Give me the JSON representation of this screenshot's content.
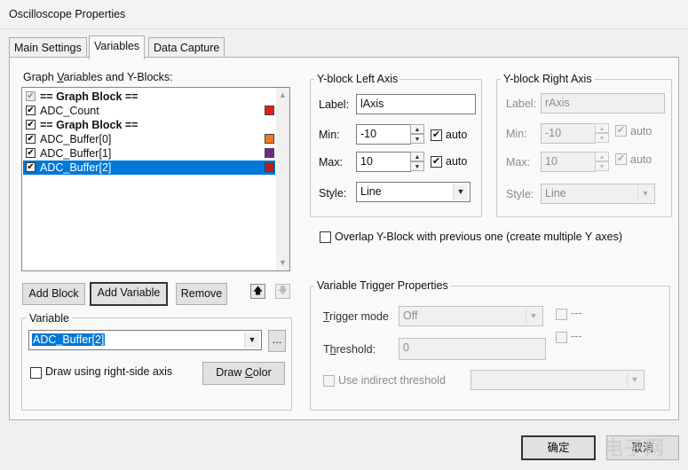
{
  "window": {
    "title": "Oscilloscope Properties"
  },
  "tabs": [
    "Main Settings",
    "Variables",
    "Data Capture"
  ],
  "graph_list": {
    "title": "Graph Variables and Y-Blocks:",
    "title_mnemonic": "V",
    "items": [
      {
        "label": "== Graph Block ==",
        "type": "block",
        "checked": true,
        "gray": true,
        "color": ""
      },
      {
        "label": "ADC_Count",
        "type": "variable",
        "checked": true,
        "color": "#e02020"
      },
      {
        "label": "== Graph Block ==",
        "type": "block",
        "checked": true,
        "color": ""
      },
      {
        "label": "ADC_Buffer[0]",
        "type": "variable",
        "checked": true,
        "color": "#f07820"
      },
      {
        "label": "ADC_Buffer[1]",
        "type": "variable",
        "checked": true,
        "color": "#6a2c8f"
      },
      {
        "label": "ADC_Buffer[2]",
        "type": "variable",
        "checked": true,
        "color": "#b22222",
        "selected": true
      }
    ]
  },
  "list_buttons": {
    "add_block": "Add Block",
    "add_variable": "Add Variable",
    "remove": "Remove"
  },
  "variable_group": {
    "title": "Variable",
    "selected_variable": "ADC_Buffer[2]",
    "browse_label": "...",
    "right_axis_label": "Draw using right-side axis",
    "right_axis_checked": false,
    "draw_color_label": "Draw Color"
  },
  "left_axis": {
    "title": "Y-block Left Axis",
    "label_caption": "Label:",
    "label_value": "lAxis",
    "min_caption": "Min:",
    "min_value": "-10",
    "min_auto": "auto",
    "max_caption": "Max:",
    "max_value": "10",
    "max_auto": "auto",
    "style_caption": "Style:",
    "style_value": "Line"
  },
  "right_axis": {
    "title": "Y-block Right Axis",
    "label_caption": "Label:",
    "label_value": "rAxis",
    "min_caption": "Min:",
    "min_value": "-10",
    "min_auto": "auto",
    "max_caption": "Max:",
    "max_value": "10",
    "max_auto": "auto",
    "style_caption": "Style:",
    "style_value": "Line"
  },
  "overlap_label": "Overlap Y-Block with previous one (create multiple Y axes)",
  "trigger": {
    "title": "Variable Trigger Properties",
    "mode_caption": "Trigger mode",
    "mode_value": "Off",
    "threshold_caption": "Threshold:",
    "threshold_value": "0",
    "dash1": "---",
    "dash2": "---",
    "indirect_label": "Use indirect threshold"
  },
  "footer": {
    "ok_label": "确定",
    "cancel_label": "取消"
  },
  "watermark": "电子网"
}
